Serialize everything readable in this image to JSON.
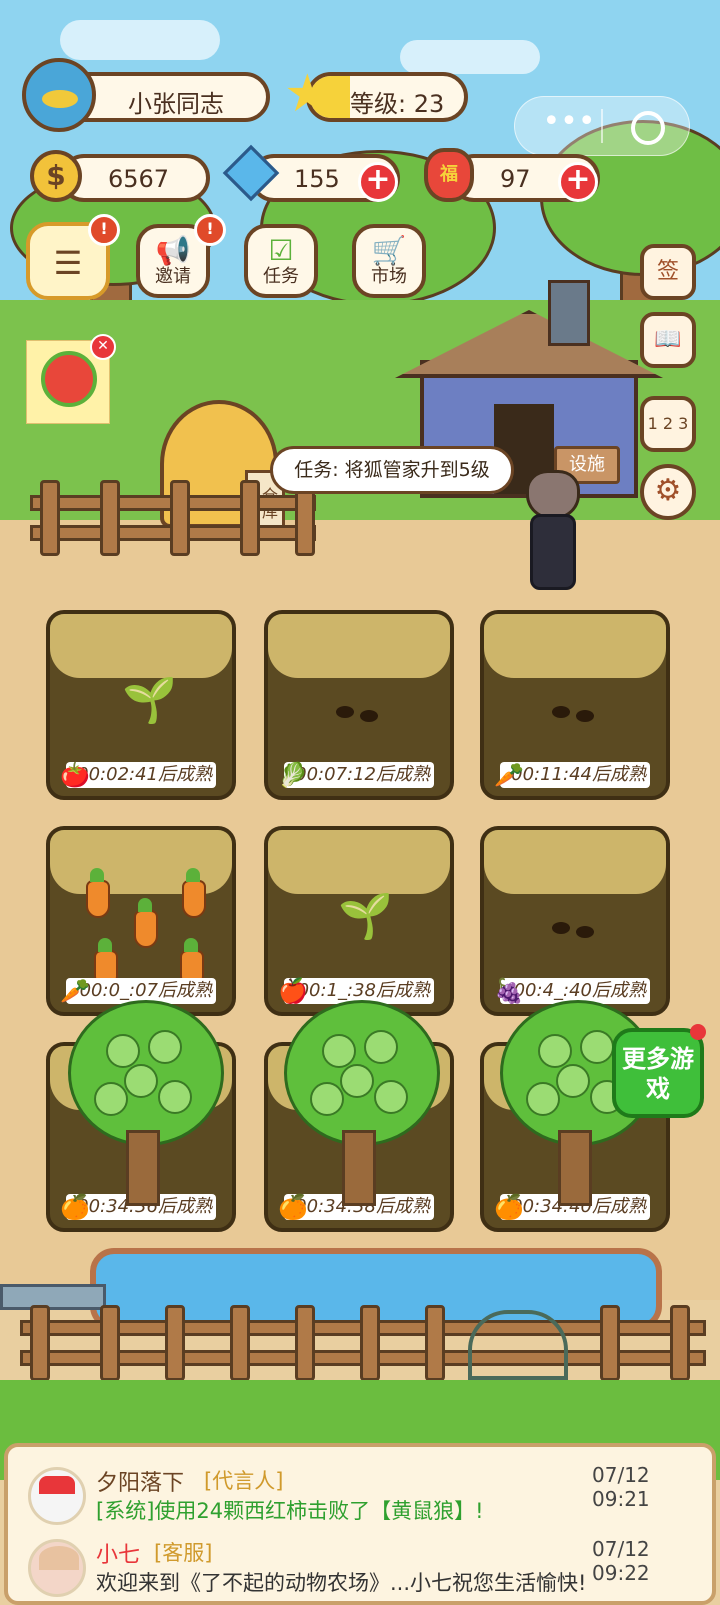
{
  "player": {
    "name": "小张同志",
    "level": "等级: 23"
  },
  "currencies": {
    "coins": "6567",
    "diamonds": "155",
    "lucky_bags": "97",
    "lucky_bag_mark": "福"
  },
  "menu": {
    "invite_label": "邀请",
    "task_label": "任务",
    "market_label": "市场"
  },
  "side": {
    "sign_label": "签",
    "rank_label": "1 2 3"
  },
  "scene": {
    "task_bubble": "任务: 将狐管家升到5级",
    "facility_sign": "设施",
    "warehouse_sign": "仓库"
  },
  "more_games": "更多游戏",
  "plots": [
    {
      "crop": "tomato",
      "timer": "00:02:41后成熟"
    },
    {
      "crop": "cabbage",
      "timer": "00:07:12后成熟"
    },
    {
      "crop": "carrot",
      "timer": "00:11:44后成熟"
    },
    {
      "crop": "carrot",
      "timer": "00:0_:07后成熟"
    },
    {
      "crop": "apple",
      "timer": "00:1_:38后成熟"
    },
    {
      "crop": "grape",
      "timer": "00:4_:40后成熟"
    },
    {
      "crop": "orange",
      "timer": "00:34:36后成熟"
    },
    {
      "crop": "orange",
      "timer": "00:34:38后成熟"
    },
    {
      "crop": "orange",
      "timer": "00:34:40后成熟"
    }
  ],
  "chat": [
    {
      "name": "夕阳落下",
      "role": "[代言人]",
      "time": "07/12 09:21",
      "message": "[系统]使用24颗西红柿击败了【黄鼠狼】!"
    },
    {
      "name": "小七",
      "role": "[客服]",
      "time": "07/12 09:22",
      "message": "欢迎来到《了不起的动物农场》...小七祝您生活愉快!"
    }
  ]
}
